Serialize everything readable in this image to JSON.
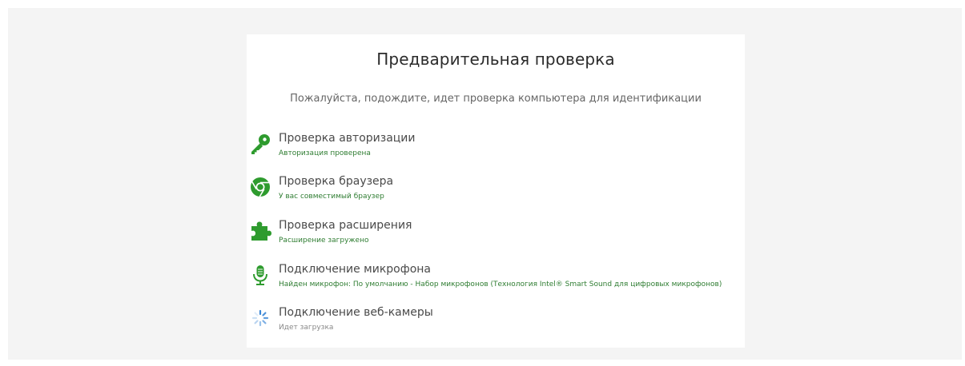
{
  "page": {
    "title": "Предварительная проверка",
    "subtitle": "Пожалуйста, подождите, идет проверка компьютера для идентификации"
  },
  "checks": [
    {
      "icon": "key-icon",
      "title": "Проверка авторизации",
      "status": "Авторизация проверена",
      "state": "done"
    },
    {
      "icon": "chrome-icon",
      "title": "Проверка браузера",
      "status": "У вас совместимый браузер",
      "state": "done"
    },
    {
      "icon": "puzzle-icon",
      "title": "Проверка расширения",
      "status": "Расширение загружено",
      "state": "done"
    },
    {
      "icon": "microphone-icon",
      "title": "Подключение микрофона",
      "status": "Найден микрофон: По умолчанию - Набор микрофонов (Технология Intel® Smart Sound для цифровых микрофонов)",
      "state": "done"
    },
    {
      "icon": "loading-spinner-icon",
      "title": "Подключение веб-камеры",
      "status": "Идет загрузка",
      "state": "loading"
    }
  ],
  "colors": {
    "success": "#2e9b2e",
    "status_text": "#2f7d32",
    "spinner": "#3a87d6"
  }
}
